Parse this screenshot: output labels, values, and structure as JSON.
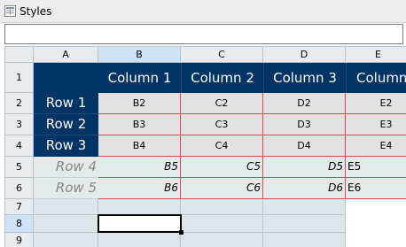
{
  "window": {
    "title": "Styles"
  },
  "formula_bar": {
    "value": ""
  },
  "columns": [
    "A",
    "B",
    "C",
    "D",
    "E"
  ],
  "rows": [
    "1",
    "2",
    "3",
    "4",
    "5",
    "6",
    "7",
    "8",
    "9"
  ],
  "table": {
    "headers": [
      "Column 1",
      "Column 2",
      "Column 3",
      "Column"
    ],
    "row_labels": [
      "Row 1",
      "Row 2",
      "Row 3"
    ],
    "cells": [
      [
        "B2",
        "C2",
        "D2",
        "E2"
      ],
      [
        "B3",
        "C3",
        "D3",
        "E3"
      ],
      [
        "B4",
        "C4",
        "D4",
        "E4"
      ]
    ],
    "italic_rows": [
      {
        "label": "Row 4",
        "b": "B5",
        "c": "C5",
        "d": "D5",
        "e": "E5"
      },
      {
        "label": "Row 5",
        "b": "B6",
        "c": "C6",
        "d": "D6",
        "e": "E6"
      }
    ]
  },
  "colors": {
    "header_bg": "#003366",
    "header_text": "#ffffff",
    "cell_bg": "#e2e2e2",
    "border_red": "#c85050",
    "selection_hdr": "#cfe3f7"
  }
}
